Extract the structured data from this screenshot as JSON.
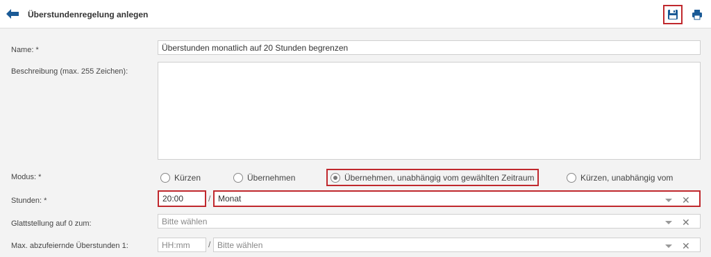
{
  "header": {
    "title": "Überstundenregelung anlegen",
    "back_icon": "arrow-left-icon",
    "save_icon": "floppy-disk-icon",
    "print_icon": "printer-icon",
    "accent_color": "#1a5a96",
    "highlight_color": "#c0282d"
  },
  "form": {
    "name": {
      "label": "Name: *",
      "value": "Überstunden monatlich auf 20 Stunden begrenzen"
    },
    "description": {
      "label": "Beschreibung (max. 255 Zeichen):",
      "value": ""
    },
    "mode": {
      "label": "Modus: *",
      "options": [
        "Kürzen",
        "Übernehmen",
        "Übernehmen, unabhängig vom gewählten Zeitraum",
        "Kürzen, unabhängig vom"
      ],
      "selected": "Übernehmen, unabhängig vom gewählten Zeitraum"
    },
    "hours": {
      "label": "Stunden: *",
      "time_value": "20:00",
      "separator": "/",
      "period_value": "Monat"
    },
    "settlement": {
      "label": "Glattstellung auf 0 zum:",
      "placeholder": "Bitte wählen"
    },
    "max_overtime": {
      "label": "Max. abzufeiernde Überstunden 1:",
      "time_placeholder": "HH:mm",
      "separator": "/",
      "period_placeholder": "Bitte wählen"
    }
  }
}
